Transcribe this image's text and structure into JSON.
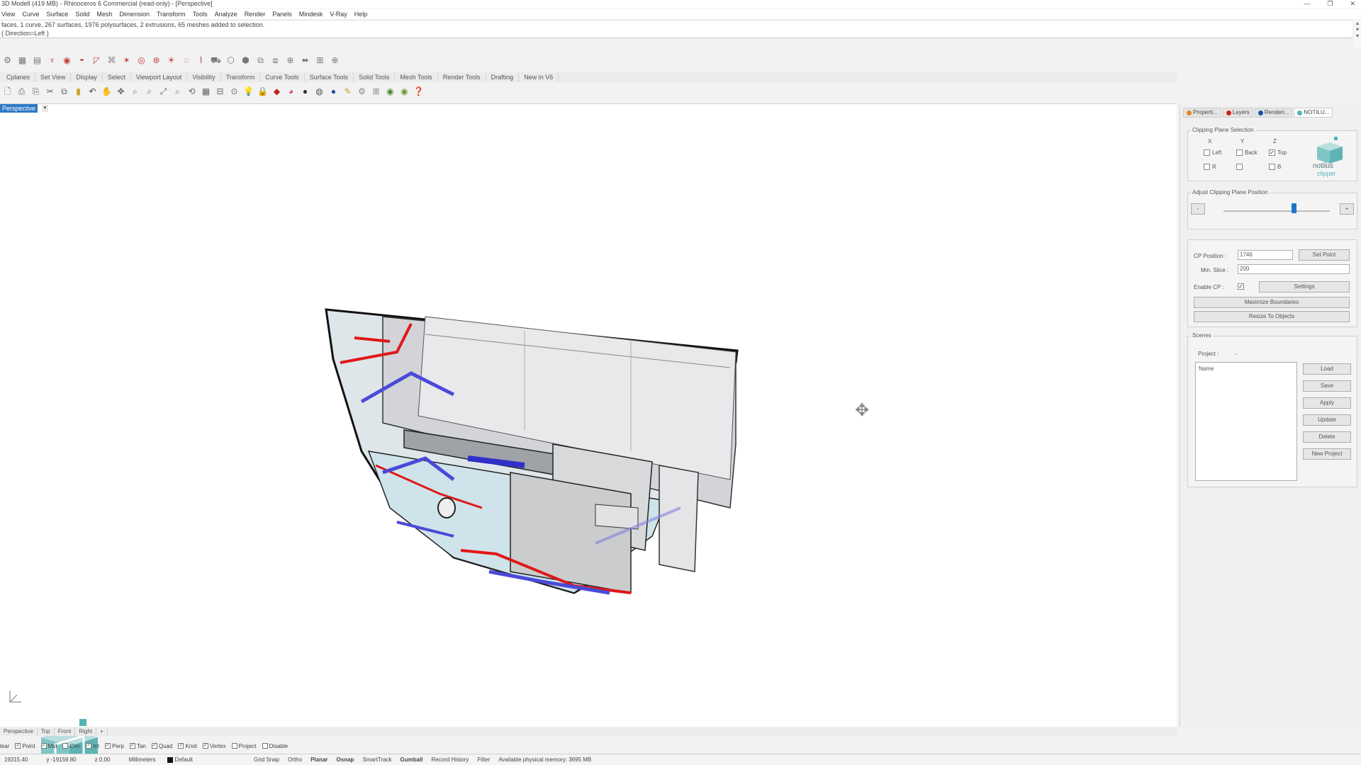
{
  "window": {
    "title": "3D Modell (419 MB) - Rhinoceros 6 Commercial (read-only) - [Perspective]",
    "controls": [
      "—",
      "❐",
      "✕"
    ]
  },
  "menu": [
    "View",
    "Curve",
    "Surface",
    "Solid",
    "Mesh",
    "Dimension",
    "Transform",
    "Tools",
    "Analyze",
    "Render",
    "Panels",
    "Mindesk",
    "V-Ray",
    "Help"
  ],
  "command_history": {
    "line1": "faces, 1 curve, 267 surfaces, 1976 polysurfaces, 2 extrusions, 65 meshes added to selection.",
    "line2": "( Direction=Left )"
  },
  "toolbar_tabs": [
    "Cplanes",
    "Set View",
    "Display",
    "Select",
    "Viewport Layout",
    "Visibility",
    "Transform",
    "Curve Tools",
    "Surface Tools",
    "Solid Tools",
    "Mesh Tools",
    "Render Tools",
    "Drafting",
    "New in V6"
  ],
  "viewport": {
    "label": "Perspective",
    "dropdown": "▾"
  },
  "watermark": {
    "brand": "notilus",
    "sub": "clipper"
  },
  "right_panel": {
    "tabs": [
      "Properti...",
      "Layers",
      "Renderi...",
      "NOTILU..."
    ],
    "clipping_selection": {
      "title": "Clipping Plane Selection",
      "axis_x": "X",
      "axis_y": "Y",
      "axis_z": "Z",
      "opts_row1": [
        "Left",
        "Back",
        "Top"
      ],
      "opts_row2": [
        "R",
        "",
        "B"
      ],
      "checked": [
        false,
        false,
        true,
        false,
        false,
        false
      ]
    },
    "adjust": {
      "title": "Adjust Clipping Plane Position",
      "minus": "-",
      "plus": "+",
      "slider_value": 0.66
    },
    "cp": {
      "position_label": "CP Position :",
      "position_value": "1746",
      "set_point": "Set Point",
      "min_slice_label": "Min. Slice :",
      "min_slice_value": "200",
      "enable_label": "Enable CP :",
      "enable_checked": true,
      "settings": "Settings",
      "maximize": "Maximize Boundaries",
      "resize": "Resize To Objects"
    },
    "scenes": {
      "title": "Scenes",
      "project_label": "Project :",
      "project_value": "-",
      "list_header": "Name",
      "buttons": [
        "Load",
        "Save",
        "Apply",
        "Update",
        "Delete",
        "New Project"
      ]
    },
    "logo": {
      "brand": "notilus",
      "sub": "clipper"
    }
  },
  "viewport_tabs": [
    "Perspective",
    "Top",
    "Front",
    "Right",
    "+"
  ],
  "osnap": [
    {
      "label": "Point",
      "checked": true
    },
    {
      "label": "Mid",
      "checked": true
    },
    {
      "label": "Cen",
      "checked": false
    },
    {
      "label": "Int",
      "checked": true
    },
    {
      "label": "Perp",
      "checked": true
    },
    {
      "label": "Tan",
      "checked": true
    },
    {
      "label": "Quad",
      "checked": true
    },
    {
      "label": "Knot",
      "checked": true
    },
    {
      "label": "Vertex",
      "checked": true
    },
    {
      "label": "Project",
      "checked": false
    },
    {
      "label": "Disable",
      "checked": false
    }
  ],
  "osnap_prefix": "lear",
  "status": {
    "x": "19315.40",
    "y": "y -19159.80",
    "z": "z 0.00",
    "units": "Millimeters",
    "layer": "Default",
    "items": [
      "Grid Snap",
      "Ortho",
      "Planar",
      "Osnap",
      "SmartTrack",
      "Gumball",
      "Record History",
      "Filter",
      "Available physical memory: 3695 MB"
    ],
    "bold": [
      false,
      false,
      true,
      true,
      false,
      true,
      false,
      false,
      false
    ]
  },
  "colors": {
    "accent": "#2e78c6",
    "teal": "#56b4b6",
    "red_frame": "#e01818",
    "blue_frame": "#4a4ad8"
  }
}
